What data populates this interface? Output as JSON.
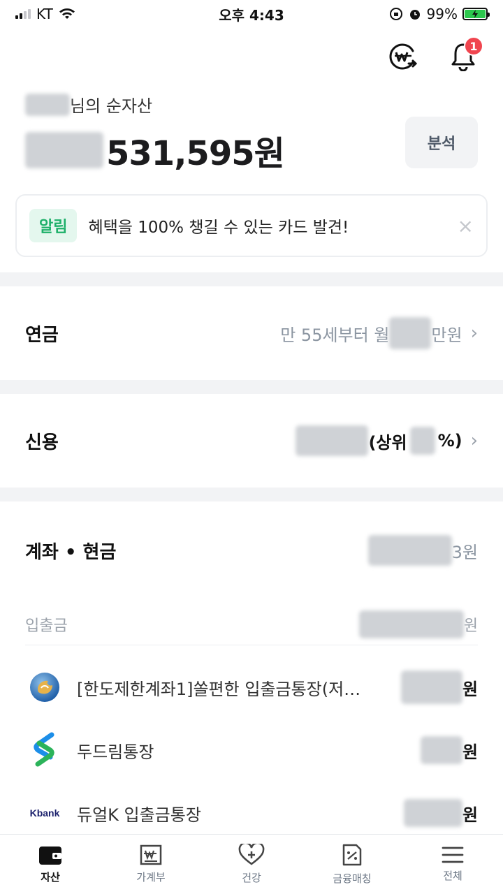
{
  "status_bar": {
    "carrier": "KT",
    "time": "오후 4:43",
    "battery": "99%"
  },
  "notifications": {
    "badge_count": "1"
  },
  "asset": {
    "label_suffix": "님의 순자산",
    "amount_visible": "531,595원",
    "analysis_button": "분석"
  },
  "notice": {
    "tag": "알림",
    "text": "혜택을 100% 챙길 수 있는 카드 발견!",
    "close": "×"
  },
  "pension": {
    "title": "연금",
    "value_prefix": "만 55세부터 월",
    "value_suffix": "만원"
  },
  "credit": {
    "title": "신용",
    "value_prefix": "(상위",
    "value_suffix": "%)"
  },
  "accounts": {
    "title": "계좌 • 현금",
    "total_suffix": "3원",
    "subsection_title": "입출금",
    "subsection_suffix": "원",
    "items": [
      {
        "name": "[한도제한계좌1]쏠편한 입출금통장(저…",
        "amount_suffix": "원",
        "logo": "shinhan-logo"
      },
      {
        "name": "두드림통장",
        "amount_suffix": "원",
        "logo": "sc-logo"
      },
      {
        "name": "듀얼K 입출금통장",
        "amount_suffix": "원",
        "logo": "kbank-logo",
        "logo_text": "Kbank"
      }
    ]
  },
  "bottom_nav": [
    {
      "label": "자산",
      "icon": "wallet-icon",
      "active": true
    },
    {
      "label": "가계부",
      "icon": "ledger-icon",
      "active": false
    },
    {
      "label": "건강",
      "icon": "heart-plus-icon",
      "active": false
    },
    {
      "label": "금융매칭",
      "icon": "percent-tag-icon",
      "active": false
    },
    {
      "label": "전체",
      "icon": "menu-icon",
      "active": false
    }
  ],
  "colors": {
    "accent_green": "#1eb06a",
    "badge_red": "#f0454f",
    "divider": "#f2f3f5"
  }
}
